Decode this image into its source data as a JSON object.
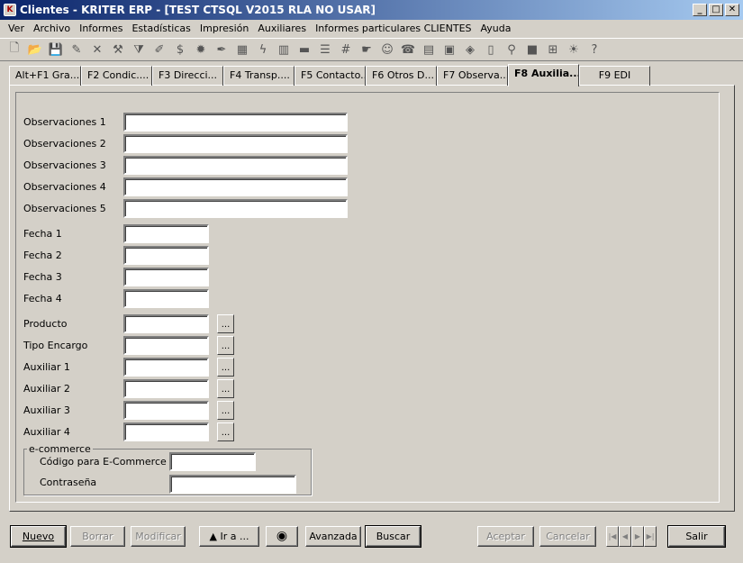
{
  "window": {
    "title": "Clientes - KRITER ERP - [TEST CTSQL V2015 RLA NO USAR]",
    "min": "_",
    "max": "□",
    "close": "✕"
  },
  "menu": [
    "Ver",
    "Archivo",
    "Informes",
    "Estadísticas",
    "Impresión",
    "Auxiliares",
    "Informes particulares CLIENTES",
    "Ayuda"
  ],
  "toolbar_icons": [
    "new-doc-icon",
    "open-folder-icon",
    "save-icon",
    "edit-icon",
    "delete-icon",
    "hammer-icon",
    "funnel-icon",
    "brush-icon",
    "dollar-icon",
    "gear-icon",
    "pen-icon",
    "grid-icon",
    "lightning-icon",
    "bar-chart-icon",
    "minus-icon",
    "list-icon",
    "numbers-icon",
    "hand-icon",
    "user-icon",
    "phone-icon",
    "document-icon",
    "calendar-icon",
    "tag-icon",
    "page-icon",
    "link-icon",
    "stop-icon",
    "tree-icon",
    "bulb-icon",
    "help-icon"
  ],
  "tabs": [
    {
      "label": "Alt+F1 Gra...",
      "w": 80
    },
    {
      "label": "F2 Condic....",
      "w": 79
    },
    {
      "label": "F3 Direcci...",
      "w": 79
    },
    {
      "label": "F4 Transp....",
      "w": 79
    },
    {
      "label": "F5 Contacto...",
      "w": 79
    },
    {
      "label": "F6 Otros D...",
      "w": 79
    },
    {
      "label": "F7 Observa...",
      "w": 79
    },
    {
      "label": "F8 Auxilia...",
      "w": 79,
      "active": true
    },
    {
      "label": "F9 EDI",
      "w": 79
    }
  ],
  "fields": {
    "obs1": {
      "label": "Observaciones 1",
      "value": ""
    },
    "obs2": {
      "label": "Observaciones 2",
      "value": ""
    },
    "obs3": {
      "label": "Observaciones 3",
      "value": ""
    },
    "obs4": {
      "label": "Observaciones 4",
      "value": ""
    },
    "obs5": {
      "label": "Observaciones 5",
      "value": ""
    },
    "fecha1": {
      "label": "Fecha 1",
      "value": ""
    },
    "fecha2": {
      "label": "Fecha 2",
      "value": ""
    },
    "fecha3": {
      "label": "Fecha 3",
      "value": ""
    },
    "fecha4": {
      "label": "Fecha 4",
      "value": ""
    },
    "producto": {
      "label": "Producto",
      "value": ""
    },
    "tipo": {
      "label": "Tipo Encargo",
      "value": ""
    },
    "aux1": {
      "label": "Auxiliar 1",
      "value": ""
    },
    "aux2": {
      "label": "Auxiliar 2",
      "value": ""
    },
    "aux3": {
      "label": "Auxiliar 3",
      "value": ""
    },
    "aux4": {
      "label": "Auxiliar 4",
      "value": ""
    }
  },
  "lookup_label": "...",
  "ecommerce": {
    "legend": "e-commerce",
    "code_label": "Código para E-Commerce",
    "code_value": "",
    "pass_label": "Contraseña",
    "pass_value": ""
  },
  "buttons": {
    "nuevo": "Nuevo",
    "borrar": "Borrar",
    "modificar": "Modificar",
    "ira": "▲ Ir a ...",
    "avanzada": "Avanzada",
    "buscar": "Buscar",
    "aceptar": "Aceptar",
    "cancelar": "Cancelar",
    "salir": "Salir"
  }
}
